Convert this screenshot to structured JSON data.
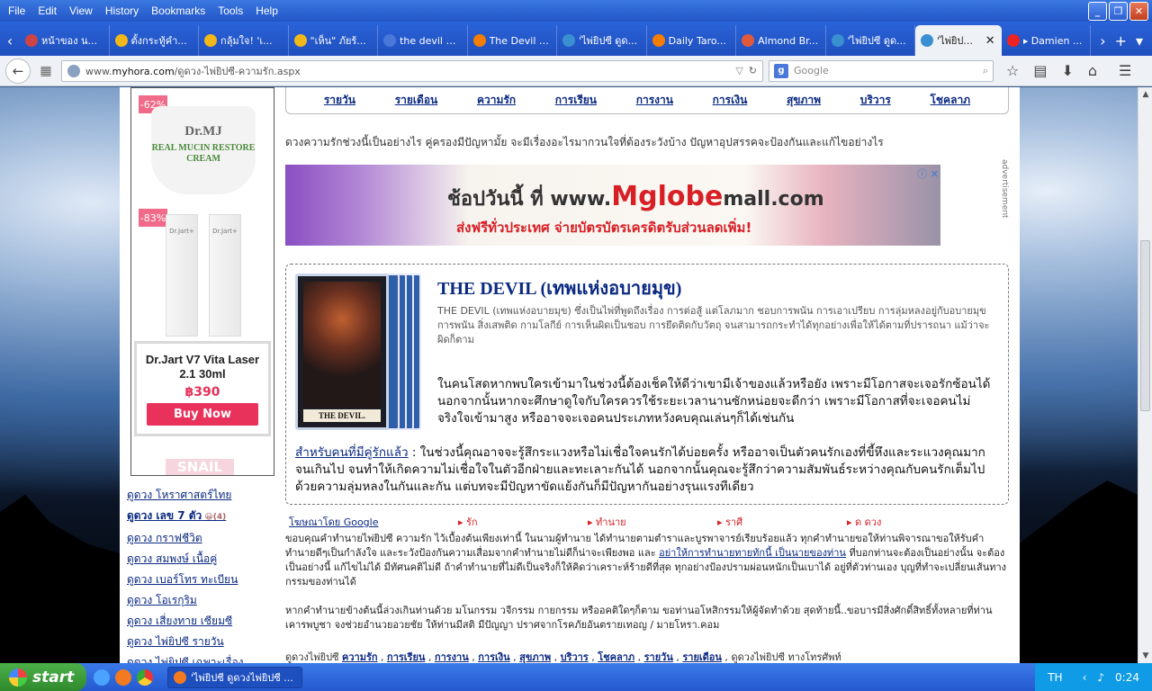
{
  "menubar": [
    "File",
    "Edit",
    "View",
    "History",
    "Bookmarks",
    "Tools",
    "Help"
  ],
  "tabs": [
    {
      "label": "หน้าของ น...",
      "fav": "#c44"
    },
    {
      "label": "ตั้งกระทู้คำ...",
      "fav": "#f2b81a"
    },
    {
      "label": "กลุ้มใจ! 'เ...",
      "fav": "#f2b81a"
    },
    {
      "label": "\"เห็น\" ภัยร้...",
      "fav": "#f2b81a"
    },
    {
      "label": "the devil ค...",
      "fav": "#4a78d8"
    },
    {
      "label": "The Devil |...",
      "fav": "#f57d00"
    },
    {
      "label": "'ไพ่ยิปซี ดูด...",
      "fav": "#3a8fd0"
    },
    {
      "label": "Daily Taro...",
      "fav": "#f57d00"
    },
    {
      "label": "Almond Br...",
      "fav": "#e05a3a"
    },
    {
      "label": "'ไพ่ยิปซี ดูด...",
      "fav": "#3a8fd0"
    },
    {
      "label": "'ไพ่ยิป...",
      "fav": "#3a8fd0",
      "active": true
    },
    {
      "label": "▸ Damien ...",
      "fav": "#e22"
    }
  ],
  "url": {
    "prefix": "www.",
    "domain": "myhora.com",
    "path": "/ดูดวง-ไพ่ยิปซี-ความรัก.aspx"
  },
  "search": {
    "engine": "g",
    "placeholder": "Google"
  },
  "topnav": [
    "รายวัน",
    "รายเดือน",
    "ความรัก",
    "การเรียน",
    "การงาน",
    "การเงิน",
    "สุขภาพ",
    "บริวาร",
    "โชคลาภ"
  ],
  "intro": "ดวงความรักช่วงนี้เป็นอย่างไร คู่ครองมีปัญหามั้ย จะมีเรื่องอะไรมากวนใจที่ต้องระวังบ้าง ปัญหาอุปสรรคจะป้องกันและแก้ไขอย่างไร",
  "ad": {
    "line1_pre": "ช้อปวันนี้ ที่ www.",
    "line1_brand": "Mglobe",
    "line1_post": "mall.com",
    "line2": "ส่งฟรีทั่วประเทศ จ่ายบัตรบัตรเครดิตรับส่วนลดเพิ่ม!",
    "label": "advertisement"
  },
  "sidebar_ad": {
    "badge1": "-62%",
    "jar_brand": "Dr.MJ",
    "jar_text": "REAL MUCIN RESTORE CREAM",
    "badge2": "-83%",
    "tube_label": "Dr.Jart+",
    "product": "Dr.Jart V7 Vita Laser 2.1 30ml",
    "price": "฿390",
    "buy": "Buy Now",
    "snail": "SNAIL"
  },
  "leftnav": [
    {
      "label": "ดูดวง โหราศาสตร์ไทย"
    },
    {
      "label": "ดูดวง เลข 7 ตัว",
      "bold": true,
      "tag": "(4)"
    },
    {
      "label": "ดูดวง กราฟชีวิต"
    },
    {
      "label": "ดูดวง สมพงษ์ เนื้อคู่"
    },
    {
      "label": "ดูดวง เบอร์โทร ทะเบียน"
    },
    {
      "label": "ดูดวง โอเรกุริม"
    },
    {
      "label": "ดูดวง เสี่ยงทาย เซียมซี"
    },
    {
      "label": "ดูดวง ไพ่ยิปซี รายวัน"
    },
    {
      "label": "ดูดวง ไพ่ยิปซี เฉพาะเรื่อง"
    }
  ],
  "card": {
    "caption": "THE DEVIL.",
    "title": "THE DEVIL (เทพแห่งอบายมุข)",
    "desc": "THE DEVIL (เทพแห่งอบายมุข) ซึ่งเป็นไพ่ที่พูดถึงเรื่อง การต่อสู้ แต่โลภมาก ชอบการพนัน การเอาเปรียบ การลุ่มหลงอยู่กับอบายมุข การพนัน สิ่งเสพติด กามโลกีย์ การเห็นผิดเป็นชอบ การยึดติดกับวัตถุ จนสามารถกระทำได้ทุกอย่างเพื่อให้ได้ตามที่ปรารถนา แม้ว่าจะผิดก็ตาม",
    "single": "ในคนโสดหากพบใครเข้ามาในช่วงนี้ต้องเช็คให้ดีว่าเขามีเจ้าของแล้วหรือยัง เพราะมีโอกาสจะเจอรักซ้อนได้ นอกจากนั้นหากจะศึกษาดูใจกับใครควรใช้ระยะเวลานานซักหน่อยจะดีกว่า เพราะมีโอกาสที่จะเจอคนไม่จริงใจเข้ามาสูง หรืออาจจะเจอคนประเภทหวังคบคุณเล่นๆก็ได้เช่นกัน",
    "couple_label": "สำหรับคนที่มีคู่รักแล้ว",
    "couple": " : ในช่วงนี้คุณอาจจะรู้สึกระแวงหรือไม่เชื่อใจคนรักได้บ่อยครั้ง หรืออาจเป็นตัวคนรักเองที่ขี้หึงและระแวงคุณมากจนเกินไป จนทำให้เกิดความไม่เชื่อใจในตัวอีกฝ่ายและทะเลาะกันได้ นอกจากนั้นคุณจะรู้สึกว่าความสัมพันธ์ระหว่างคุณกับคนรักเต็มไปด้วยความลุ่มหลงในกันและกัน แต่บทจะมีปัญหาขัดแย้งกันก็มีปัญหากันอย่างรุนแรงทีเดียว"
  },
  "sponsor": {
    "google": "โฆษณาโดย Google",
    "cats": [
      "▸ รัก",
      "▸ ทำนาย",
      "▸ ราศี",
      "▸ ด ดวง"
    ]
  },
  "disclaimer": {
    "text1": "ขอบคุณคำทำนายไพ่ยิปซี ความรัก ไว้เบื้องต้นเพียงเท่านี้ ในนามผู้ทำนาย ได้ทำนายตามตำราและบูรพาจารย์เรียบร้อยแล้ว ทุกคำทำนายขอให้ท่านพิจารณาขอให้รับคำทำนายดีๆเป็นกำลังใจ และระวังป้องกันความเสื่อมจากคำทำนายไม่ดีก็น่าจะเพียงพอ และ ",
    "link": "อย่าให้การทำนายทายทักนี้ เป็นนายของท่าน",
    "text2": " ที่บอกท่านจะต้องเป็นอย่างนั้น จะต้องเป็นอย่างนี้ แก้ไขไม่ได้ มีทัศนคติไม่ดี ถ้าคำทำนายที่ไม่ดีเป็นจริงก็ให้คิดว่าเคราะห์ร้ายดีที่สุด ทุกอย่างป้องปรามผ่อนหนักเป็นเบาได้ อยู่ที่ตัวท่านเอง บุญที่ทำจะเปลี่ยนเส้นทางกรรมของท่านได้",
    "blessing": "หากคำทำนายข้างต้นนี้ล่วงเกินท่านด้วย มโนกรรม วจีกรรม กายกรรม หรืออคติใดๆก็ตาม ขอท่านอโหสิกรรมให้ผู้จัดทำด้วย สุดท้ายนี้..ขอบารมีสิ่งศักดิ์สิทธิ์ทั้งหลายที่ท่านเคารพบูชา จงช่วยอำนวยอวยชัย ให้ท่านมีสติ มีปัญญา ปราศจากโรคภัยอันตรายเทอญ / มายโหรา.คอม"
  },
  "footer": {
    "prefix": "ดูดวงไพ่ยิปซี ",
    "links": [
      "ความรัก",
      "การเรียน",
      "การงาน",
      "การเงิน",
      "สุขภาพ",
      "บริวาร",
      "โชคลาภ",
      "รายวัน",
      "รายเดือน"
    ],
    "suffix": " ดูดวงไพ่ยิปซี ทางโทรศัพท์"
  },
  "taskbar": {
    "start": "start",
    "task": "'ไพ่ยิปซี ดูดวงไพ่ยิปซี ...",
    "lang": "TH",
    "time": "0:24"
  }
}
